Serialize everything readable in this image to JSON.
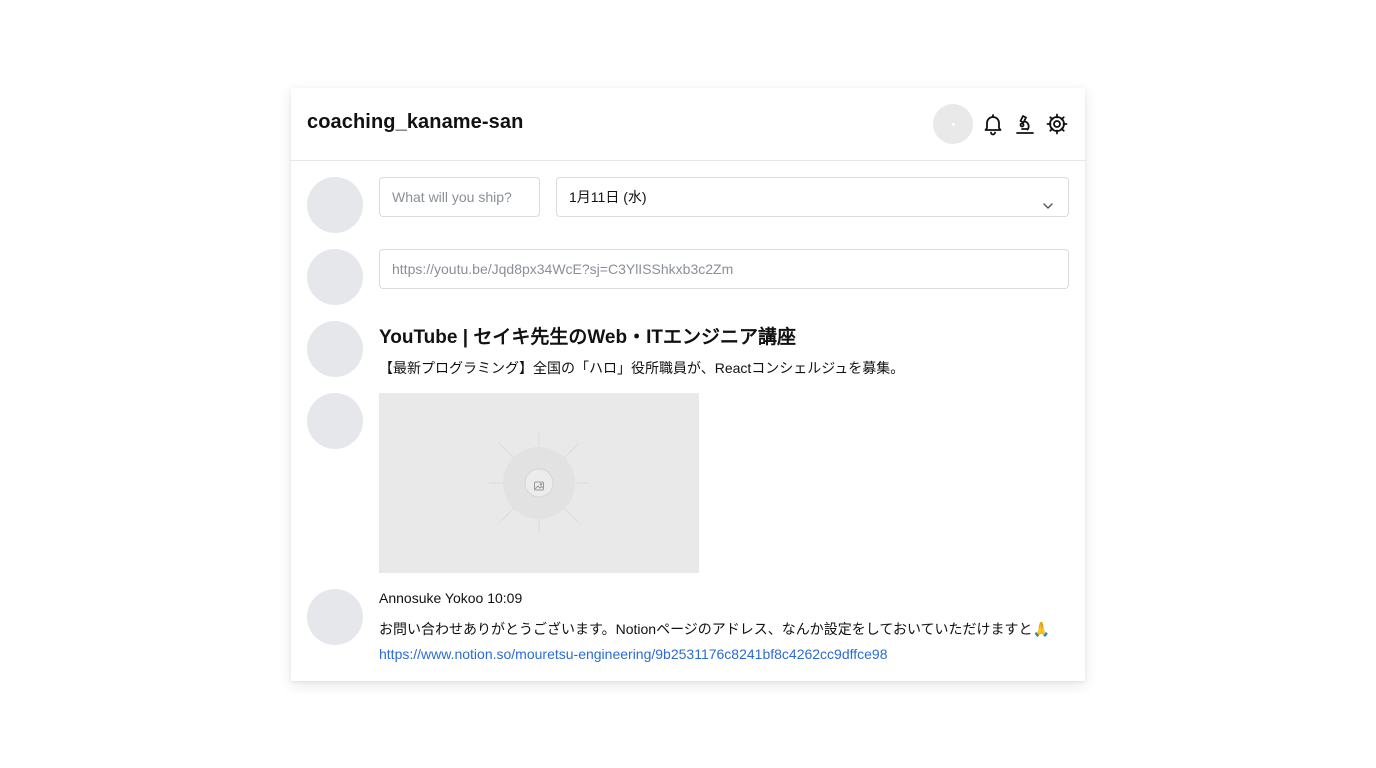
{
  "header": {
    "title": "coaching_kaname-san",
    "icons": [
      "bell-icon",
      "microscope-icon",
      "settings-icon"
    ]
  },
  "composer": {
    "ship_placeholder": "What will you ship?",
    "date_select_value": "1月11日 (水)",
    "url_placeholder": "https://youtu.be/Jqd8px34WcE?sj=C3YlISShkxb3c2Zm"
  },
  "ogp": {
    "title": "YouTube | セイキ先生のWeb・ITエンジニア講座",
    "description": "【最新プログラミング】全国の「ハロ」役所職員が、Reactコンシェルジュを募集。",
    "thumbnail_icon": "image-icon"
  },
  "message": {
    "author_time": "Annosuke Yokoo 10:09",
    "text": "お問い合わせありがとうございます。Notionページのアドレス、なんか設定をしておいていただけますと🙏",
    "link": "https://www.notion.so/mouretsu-engineering/9b2531176c8241bf8c4262cc9dffce98"
  },
  "colors": {
    "link": "#2b6cd4",
    "avatar_placeholder": "#e5e7eb",
    "thumbnail_bg": "#e9e9e9"
  }
}
